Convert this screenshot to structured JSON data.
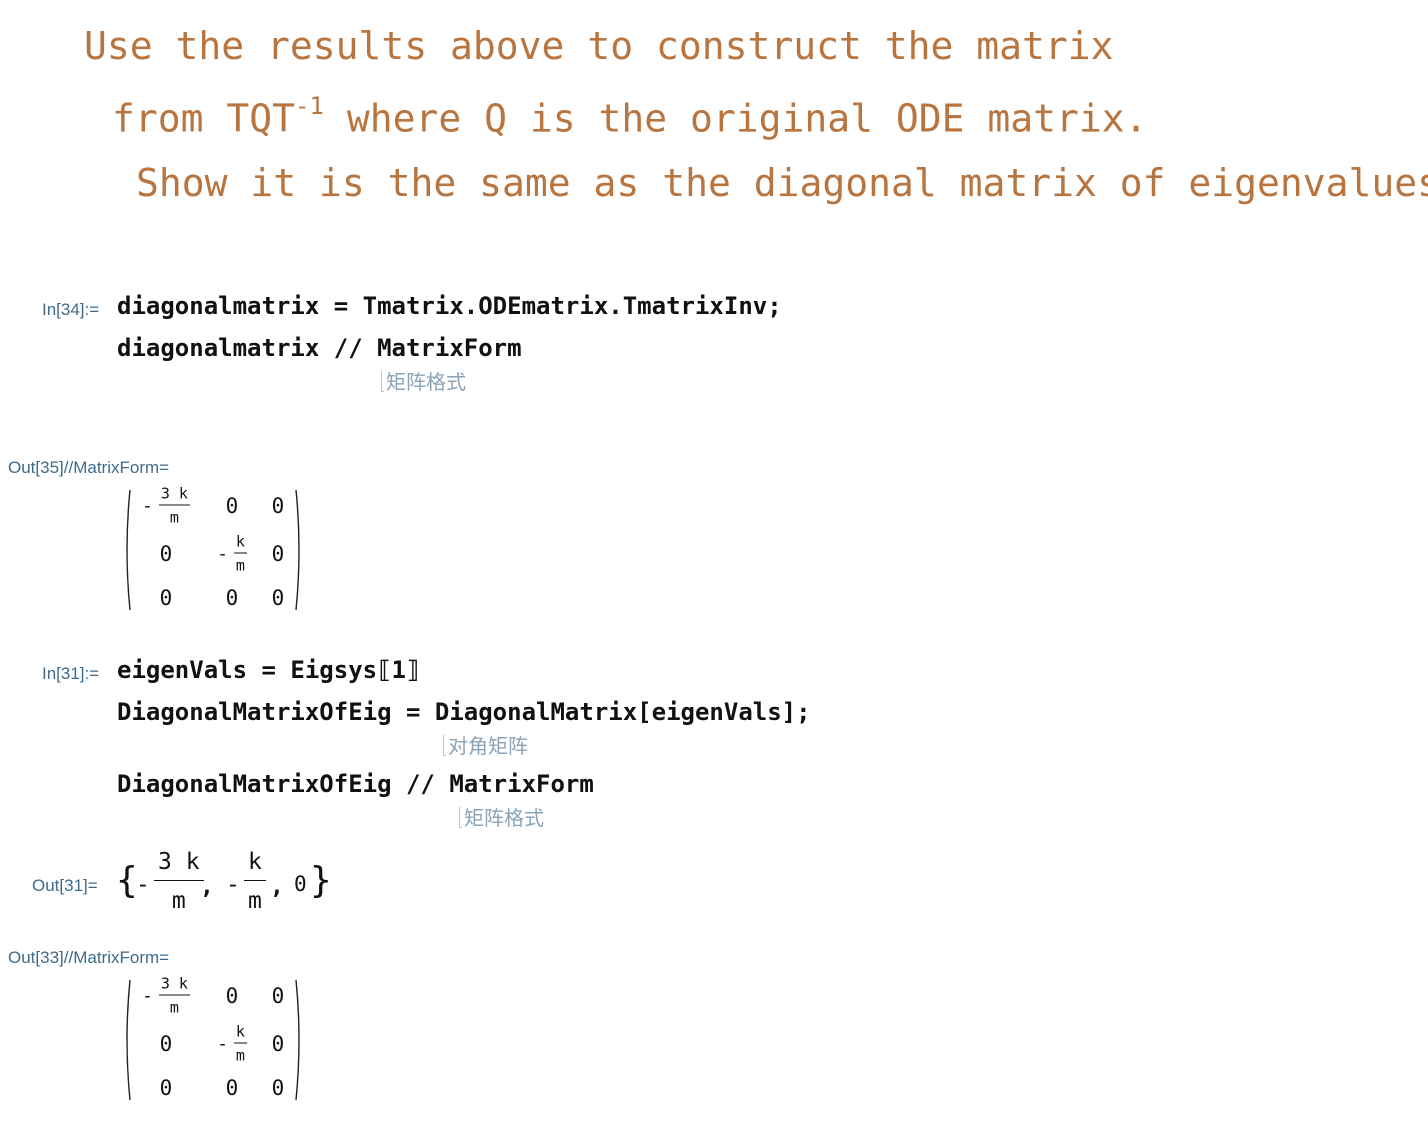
{
  "text_cell": {
    "line1": "Use the results above to construct the matrix",
    "line2_prefix": "from TQT",
    "line2_sup": "-1",
    "line2_suffix": " where Q is the original ODE matrix.",
    "line3": "Show it is the same as the diagonal matrix of eigenvalues"
  },
  "in34": {
    "label": "In[34]:=",
    "line1": "diagonalmatrix = Tmatrix.ODEmatrix.TmatrixInv;",
    "line2": "diagonalmatrix // MatrixForm",
    "tooltip": "矩阵格式"
  },
  "out35": {
    "label": "Out[35]//MatrixForm=",
    "matrix": [
      [
        {
          "minus": "-",
          "num": "3 k",
          "den": "m"
        },
        "0",
        "0"
      ],
      [
        "0",
        {
          "minus": "-",
          "num": "k",
          "den": "m"
        },
        "0"
      ],
      [
        "0",
        "0",
        "0"
      ]
    ]
  },
  "in31": {
    "label": "In[31]:=",
    "line1": "eigenVals = Eigsys⟦1⟧",
    "line2": "DiagonalMatrixOfEig = DiagonalMatrix[eigenVals];",
    "tooltip1": "对角矩阵",
    "line3": "DiagonalMatrixOfEig // MatrixForm",
    "tooltip2": "矩阵格式"
  },
  "out31": {
    "label": "Out[31]=",
    "open_brace": "{",
    "minus1": "-",
    "num1": "3 k",
    "den1": "m",
    "comma1": ",",
    "minus2": "-",
    "num2": "k",
    "den2": "m",
    "comma2": ",",
    "zero": "0",
    "close_brace": "}"
  },
  "out33": {
    "label": "Out[33]//MatrixForm=",
    "matrix": [
      [
        {
          "minus": "-",
          "num": "3 k",
          "den": "m"
        },
        "0",
        "0"
      ],
      [
        "0",
        {
          "minus": "-",
          "num": "k",
          "den": "m"
        },
        "0"
      ],
      [
        "0",
        "0",
        "0"
      ]
    ]
  }
}
